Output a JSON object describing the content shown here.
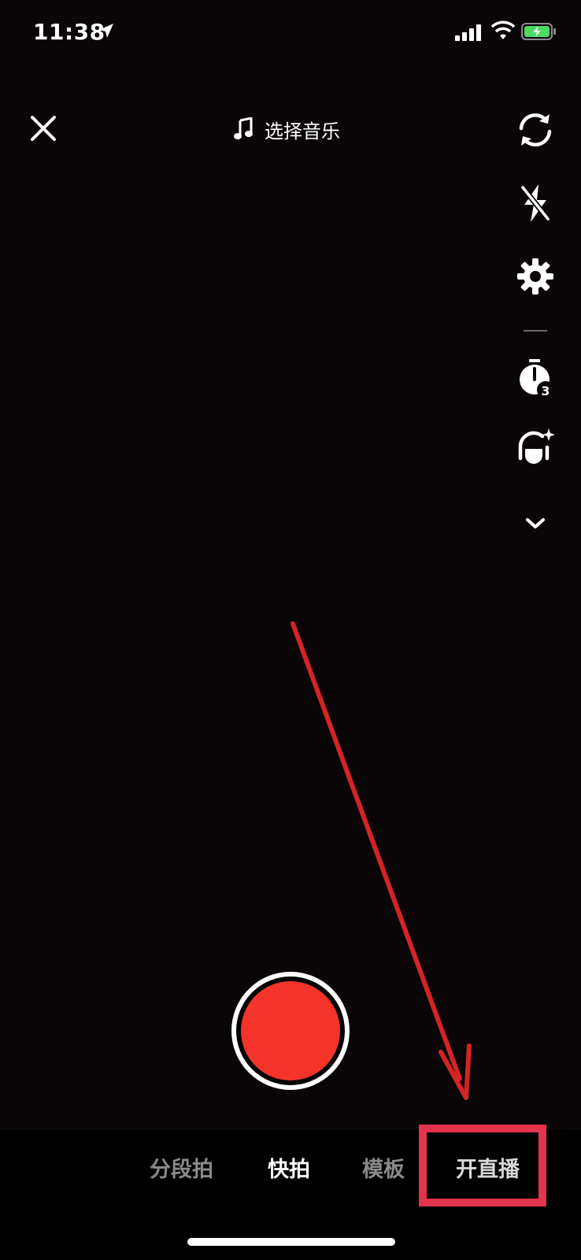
{
  "status_bar": {
    "time": "11:38",
    "icons": [
      "location-arrow-icon",
      "cellular-signal-icon",
      "wifi-icon",
      "battery-charging-icon"
    ]
  },
  "top_bar": {
    "close_icon": "close-icon",
    "music_icon": "music-note-icon",
    "music_label": "选择音乐"
  },
  "right_toolbar": {
    "items": [
      {
        "icon": "flip-camera-icon"
      },
      {
        "icon": "flash-off-icon"
      },
      {
        "icon": "settings-gear-icon"
      },
      {
        "icon": "timer-icon",
        "badge": "3"
      },
      {
        "icon": "beauty-filter-icon"
      },
      {
        "icon": "chevron-down-icon"
      }
    ]
  },
  "record": {
    "color": "#f4342a"
  },
  "modes": {
    "items": [
      {
        "label": "分段拍",
        "state": "inactive"
      },
      {
        "label": "快拍",
        "state": "active"
      },
      {
        "label": "模板",
        "state": "inactive"
      },
      {
        "label": "开直播",
        "state": "highlighted"
      }
    ]
  },
  "annotation": {
    "arrow_color": "#d42424",
    "highlight_color": "#e4334c"
  }
}
